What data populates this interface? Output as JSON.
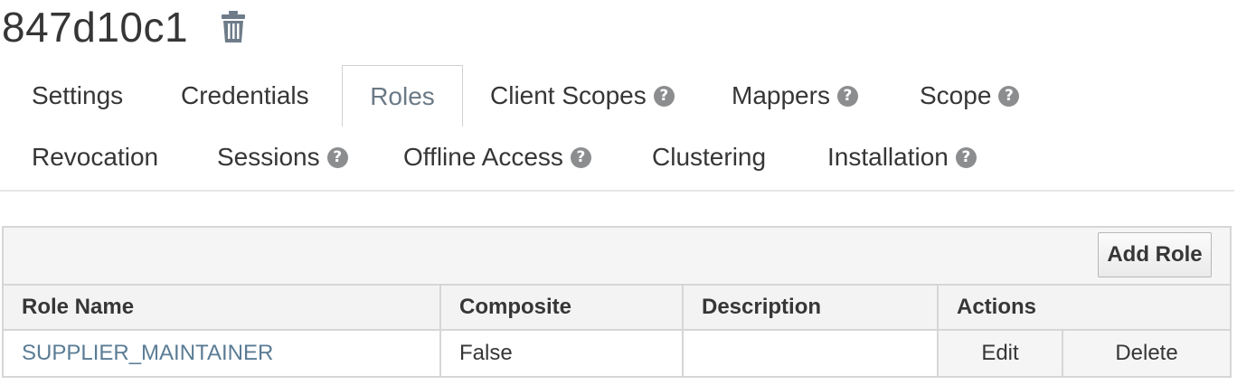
{
  "header": {
    "title": "847d10c1",
    "delete_icon": "trash-icon"
  },
  "tabs": {
    "row1": [
      {
        "label": "Settings",
        "help": false
      },
      {
        "label": "Credentials",
        "help": false
      },
      {
        "label": "Roles",
        "help": false,
        "active": true
      },
      {
        "label": "Client Scopes",
        "help": true
      },
      {
        "label": "Mappers",
        "help": true
      },
      {
        "label": "Scope",
        "help": true
      }
    ],
    "row2": [
      {
        "label": "Revocation",
        "help": false
      },
      {
        "label": "Sessions",
        "help": true
      },
      {
        "label": "Offline Access",
        "help": true
      },
      {
        "label": "Clustering",
        "help": false
      },
      {
        "label": "Installation",
        "help": true
      }
    ],
    "help_glyph": "?"
  },
  "roles_table": {
    "add_role_label": "Add Role",
    "columns": [
      "Role Name",
      "Composite",
      "Description",
      "Actions"
    ],
    "rows": [
      {
        "role_name": "SUPPLIER_MAINTAINER",
        "composite": "False",
        "description": "",
        "edit_label": "Edit",
        "delete_label": "Delete"
      }
    ]
  },
  "colors": {
    "text": "#363636",
    "active_tab_text": "#6a7986",
    "link": "#5a7c95",
    "help_icon": "#8b8d8f",
    "border": "#d6d6d6",
    "header_bg": "#f3f3f3"
  }
}
